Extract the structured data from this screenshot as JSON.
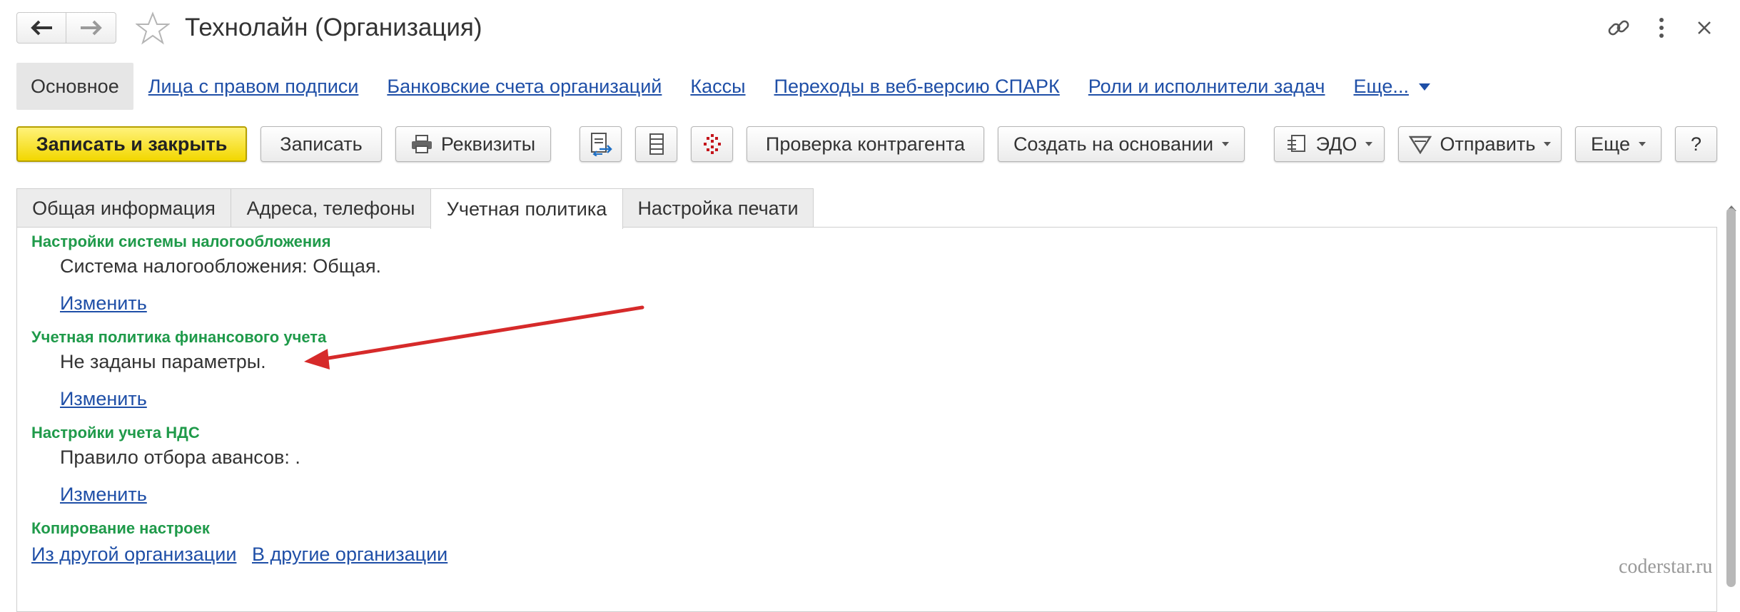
{
  "window": {
    "title": "Технолайн (Организация)"
  },
  "icons": {
    "back": "arrow-left-icon",
    "forward": "arrow-right-icon",
    "favorite": "star-icon",
    "link": "link-icon",
    "more": "more-vertical-icon",
    "close": "close-icon"
  },
  "nav": {
    "items": [
      {
        "label": "Основное",
        "active": true
      },
      {
        "label": "Лица с правом подписи"
      },
      {
        "label": "Банковские счета организаций"
      },
      {
        "label": "Кассы"
      },
      {
        "label": "Переходы в веб-версию СПАРК"
      },
      {
        "label": "Роли и исполнители задач"
      },
      {
        "label": "Еще..."
      }
    ]
  },
  "toolbar": {
    "save_close": "Записать и закрыть",
    "save": "Записать",
    "requisites": "Реквизиты",
    "check": "Проверка контрагента",
    "create_based": "Создать на основании",
    "edo": "ЭДО",
    "send": "Отправить",
    "more": "Еще",
    "help": "?"
  },
  "tabs": [
    {
      "label": "Общая информация"
    },
    {
      "label": "Адреса, телефоны"
    },
    {
      "label": "Учетная политика",
      "active": true
    },
    {
      "label": "Настройка печати"
    }
  ],
  "content": {
    "tax": {
      "heading": "Настройки системы налогообложения",
      "value": "Система налогообложения: Общая.",
      "link": "Изменить"
    },
    "accounting": {
      "heading": "Учетная политика финансового учета",
      "value": "Не заданы параметры.",
      "link": "Изменить"
    },
    "vat": {
      "heading": "Настройки учета НДС",
      "value": "Правило отбора авансов: .",
      "link": "Изменить"
    },
    "copy": {
      "heading": "Копирование настроек",
      "from_link": "Из другой организации",
      "to_link": "В другие организации"
    }
  },
  "watermark": "coderstar.ru",
  "colors": {
    "link": "#1f4fa7",
    "section_heading": "#1f9a4a",
    "primary_button": "#f2d700",
    "annotation_arrow": "#d62a2a"
  }
}
